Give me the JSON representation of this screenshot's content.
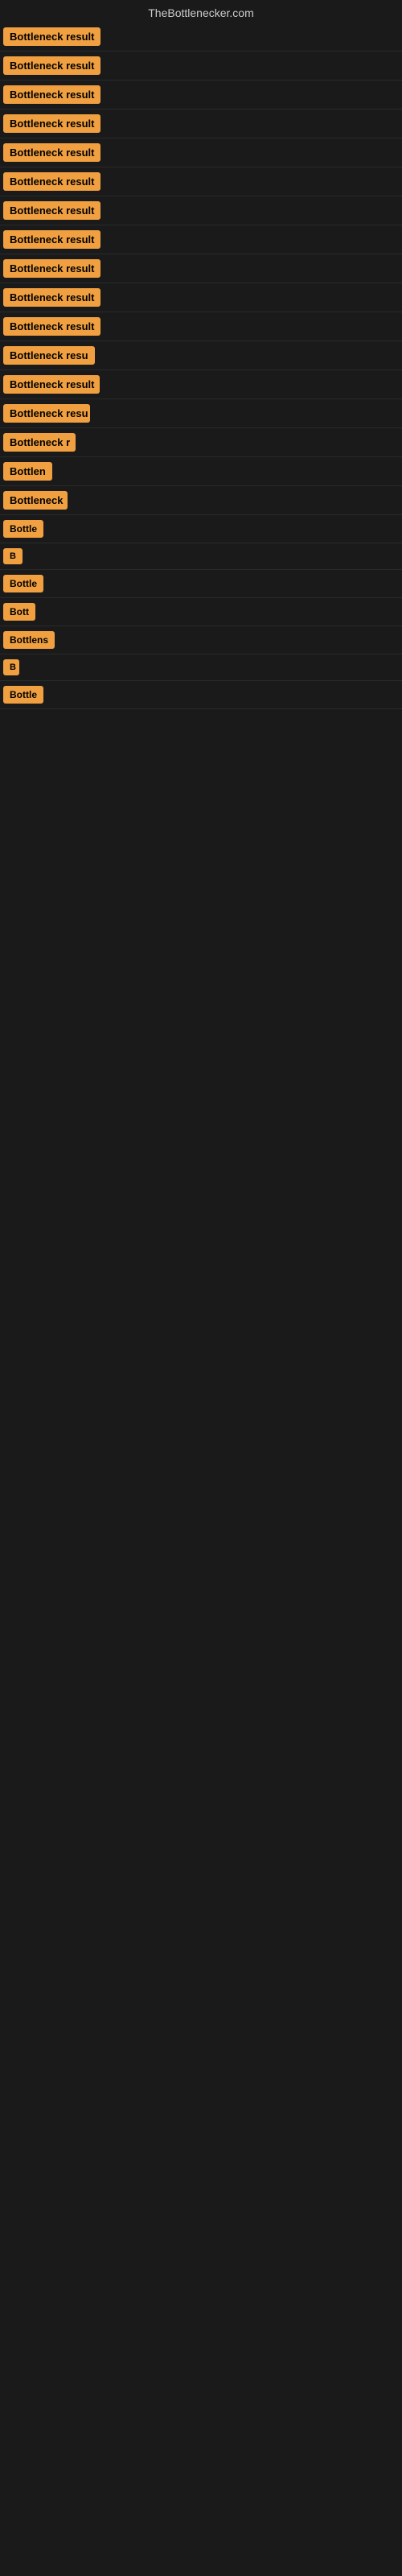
{
  "site": {
    "title": "TheBottlenecker.com"
  },
  "colors": {
    "badge_bg": "#f0a040",
    "badge_text": "#000000",
    "page_bg": "#1a1a1a"
  },
  "rows": [
    {
      "id": 1,
      "label": "Bottleneck result",
      "width": 130
    },
    {
      "id": 2,
      "label": "Bottleneck result",
      "width": 130
    },
    {
      "id": 3,
      "label": "Bottleneck result",
      "width": 130
    },
    {
      "id": 4,
      "label": "Bottleneck result",
      "width": 130
    },
    {
      "id": 5,
      "label": "Bottleneck result",
      "width": 130
    },
    {
      "id": 6,
      "label": "Bottleneck result",
      "width": 130
    },
    {
      "id": 7,
      "label": "Bottleneck result",
      "width": 130
    },
    {
      "id": 8,
      "label": "Bottleneck result",
      "width": 130
    },
    {
      "id": 9,
      "label": "Bottleneck result",
      "width": 130
    },
    {
      "id": 10,
      "label": "Bottleneck result",
      "width": 130
    },
    {
      "id": 11,
      "label": "Bottleneck result",
      "width": 130
    },
    {
      "id": 12,
      "label": "Bottleneck resu",
      "width": 115
    },
    {
      "id": 13,
      "label": "Bottleneck result",
      "width": 120
    },
    {
      "id": 14,
      "label": "Bottleneck resu",
      "width": 108
    },
    {
      "id": 15,
      "label": "Bottleneck r",
      "width": 90
    },
    {
      "id": 16,
      "label": "Bottlen",
      "width": 72
    },
    {
      "id": 17,
      "label": "Bottleneck",
      "width": 80
    },
    {
      "id": 18,
      "label": "Bottle",
      "width": 60
    },
    {
      "id": 19,
      "label": "B",
      "width": 28
    },
    {
      "id": 20,
      "label": "Bottle",
      "width": 60
    },
    {
      "id": 21,
      "label": "Bott",
      "width": 46
    },
    {
      "id": 22,
      "label": "Bottlens",
      "width": 68
    },
    {
      "id": 23,
      "label": "B",
      "width": 20
    },
    {
      "id": 24,
      "label": "Bottle",
      "width": 58
    }
  ]
}
